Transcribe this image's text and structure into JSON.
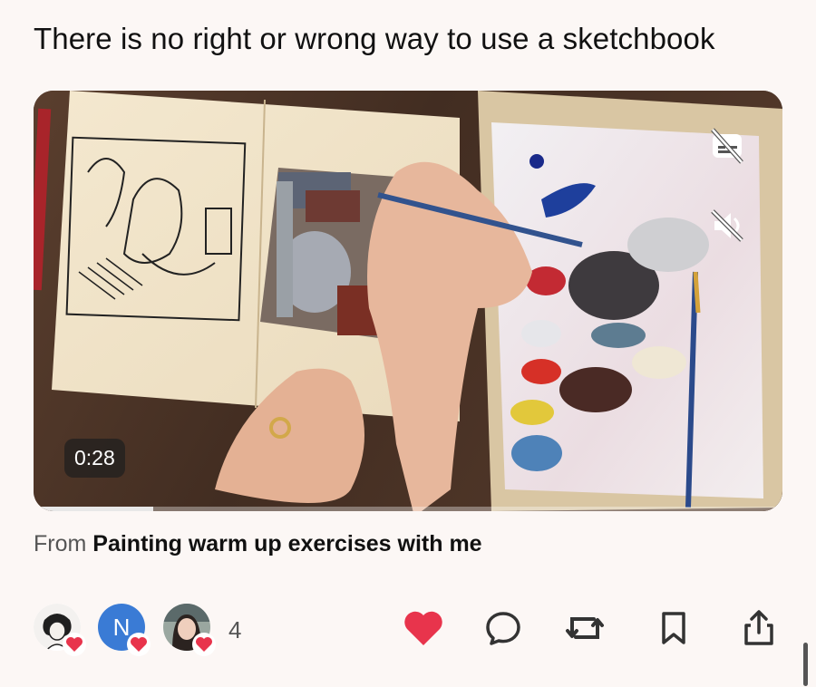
{
  "post": {
    "title": "There is no right or wrong way to use a sketchbook"
  },
  "video": {
    "duration": "0:28",
    "progress_fraction": 0.16,
    "captions_icon": "captions-off-icon",
    "mute_icon": "volume-muted-icon"
  },
  "source": {
    "prefix": "From",
    "collection": "Painting warm up exercises with me"
  },
  "reactions": {
    "avatars": [
      {
        "kind": "illustration",
        "icon": "heart-icon"
      },
      {
        "kind": "initial",
        "initial": "N",
        "color": "#3a7bd5",
        "icon": "heart-icon"
      },
      {
        "kind": "photo",
        "icon": "heart-icon"
      }
    ],
    "count": "4"
  },
  "actions": [
    {
      "name": "like",
      "icon": "heart-filled-icon",
      "color": "#e8344c"
    },
    {
      "name": "comment",
      "icon": "comment-icon"
    },
    {
      "name": "repost",
      "icon": "repost-icon"
    },
    {
      "name": "save",
      "icon": "bookmark-icon"
    },
    {
      "name": "share",
      "icon": "share-icon"
    }
  ]
}
